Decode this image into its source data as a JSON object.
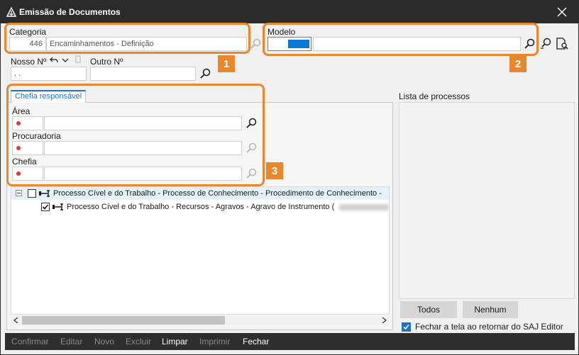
{
  "window": {
    "title": "Emissão de Documentos"
  },
  "form": {
    "categoria_label": "Categoria",
    "categoria_code": "446",
    "categoria_value": "Encaminhamentos - Definição",
    "modelo_label": "Modelo",
    "nosso_label": "Nosso Nº",
    "nosso_value": ". .",
    "outro_label": "Outro Nº"
  },
  "chefia_tab": {
    "label": "Chefia responsável",
    "area_label": "Área",
    "procuradoria_label": "Procuradoria",
    "chefia_label": "Chefia"
  },
  "tree": {
    "row1": "Processo Cível e do Trabalho - Processo de Conhecimento - Procedimento de Conhecimento -",
    "row2": "Processo Cível e do Trabalho - Recursos - Agravos - Agravo de Instrumento ("
  },
  "processos": {
    "label": "Lista de processos",
    "todos": "Todos",
    "nenhum": "Nenhum",
    "fechar_check": "Fechar a tela ao retornar do SAJ Editor"
  },
  "footer": {
    "confirmar": "Confirmar",
    "editar": "Editar",
    "novo": "Novo",
    "excluir": "Excluir",
    "limpar": "Limpar",
    "imprimir": "Imprimir",
    "fechar": "Fechar"
  },
  "callouts": [
    "1",
    "2",
    "3"
  ],
  "colors": {
    "accent": "#1e73c8",
    "callout": "#e8872c",
    "required_dot": "#e53935",
    "titlebar": "#2b2b2b"
  }
}
